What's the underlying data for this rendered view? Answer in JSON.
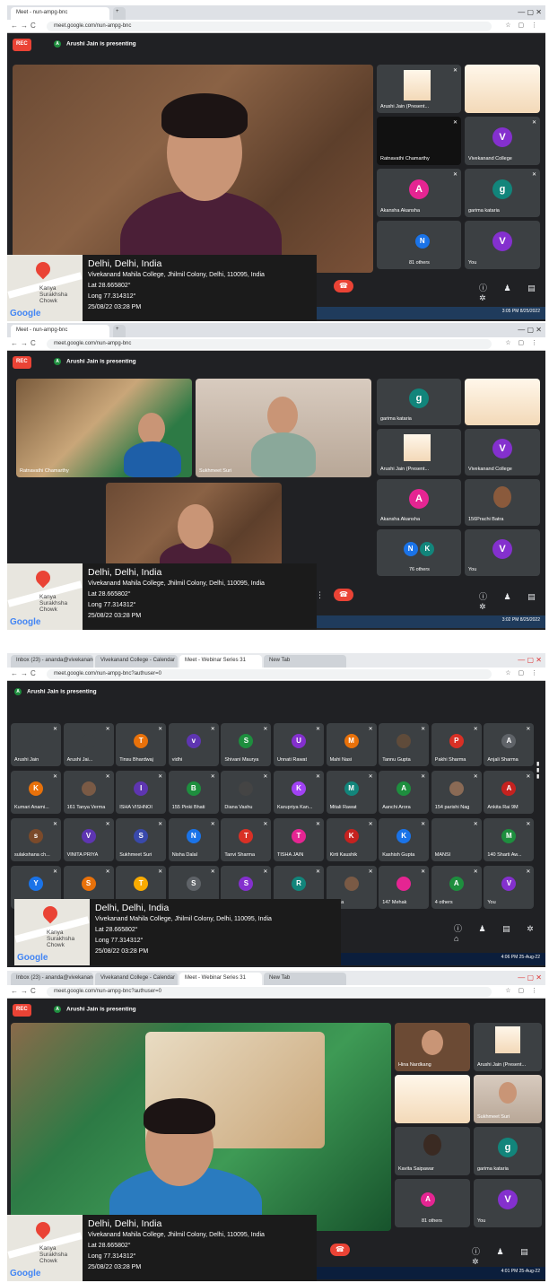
{
  "shot1": {
    "tab_title": "Meet - nun-ampg-bnc",
    "url": "meet.google.com/nun-ampg-bnc",
    "rec_label": "REC",
    "presenting_avatar": "A",
    "presenting_text": "Arushi Jain is presenting",
    "tiles": [
      {
        "name": "Arushi Jain (Present...",
        "avatar": ""
      },
      {
        "name": "",
        "avatar": ""
      },
      {
        "name": "Ratnavathi Chamarthy",
        "avatar": ""
      },
      {
        "name": "Vivekanand College",
        "avatar": "V"
      },
      {
        "name": "Akansha Akansha",
        "avatar": "A"
      },
      {
        "name": "garima kataria",
        "avatar": "g"
      },
      {
        "name": "81 others",
        "avatar": "N"
      },
      {
        "name": "You",
        "avatar": "V"
      }
    ],
    "taskbar_time": "3:05 PM",
    "taskbar_date": "8/25/2022"
  },
  "shot2": {
    "tab_title": "Meet - nun-ampg-bnc",
    "url": "meet.google.com/nun-ampg-bnc",
    "rec_label": "REC",
    "presenting_avatar": "A",
    "presenting_text": "Arushi Jain is presenting",
    "tiles": [
      {
        "name": "Ratnavathi Chamarthy",
        "avatar": ""
      },
      {
        "name": "Sukhmeet Suri",
        "avatar": ""
      },
      {
        "name": "garima kataria",
        "avatar": "g"
      },
      {
        "name": "",
        "avatar": ""
      },
      {
        "name": "Arushi Jain (Present...",
        "avatar": ""
      },
      {
        "name": "Vivekanand College",
        "avatar": "V"
      },
      {
        "name": "Akansha Akansha",
        "avatar": "A"
      },
      {
        "name": "156Prachi Batra",
        "avatar": ""
      },
      {
        "name": "76 others",
        "avatar": "N"
      },
      {
        "name": "You",
        "avatar": "V"
      }
    ],
    "others_second_avatar": "K",
    "taskbar_time": "3:02 PM",
    "taskbar_date": "8/25/2022"
  },
  "shot3": {
    "tabs": [
      "Inbox (23) - ananda@vivekanand...",
      "Vivekanand College - Calendar",
      "Meet - Webinar Series 31",
      "New Tab"
    ],
    "url": "meet.google.com/nun-ampg-bnc?authuser=0",
    "presenting_avatar": "A",
    "presenting_text": "Arushi Jain is presenting",
    "grid": [
      {
        "name": "Arushi Jain",
        "avatar": "",
        "color": "#3c4043"
      },
      {
        "name": "Arushi Jai...",
        "avatar": "",
        "color": "#3c4043"
      },
      {
        "name": "Tinsu Bhardwaj",
        "avatar": "T",
        "color": "#e8710a"
      },
      {
        "name": "vidhi",
        "avatar": "v",
        "color": "#5e35b1"
      },
      {
        "name": "Shivani Maurya",
        "avatar": "S",
        "color": "#1e8e3e"
      },
      {
        "name": "Unnati Rawat",
        "avatar": "U",
        "color": "#8430ce"
      },
      {
        "name": "Mahi Nasi",
        "avatar": "M",
        "color": "#e8710a"
      },
      {
        "name": "Tannu Gupta",
        "avatar": "",
        "color": "#5f4b3a"
      },
      {
        "name": "Pakhi Sharma",
        "avatar": "P",
        "color": "#d93025"
      },
      {
        "name": "Anjali Sharma",
        "avatar": "A",
        "color": "#5f6368"
      },
      {
        "name": "Kumari Anami...",
        "avatar": "K",
        "color": "#e8710a"
      },
      {
        "name": "161 Tanya Verma",
        "avatar": "",
        "color": "#7a5a45"
      },
      {
        "name": "ISHA VISHNOI",
        "avatar": "I",
        "color": "#5e35b1"
      },
      {
        "name": "155 Pinki Bhati",
        "avatar": "B",
        "color": "#1e8e3e"
      },
      {
        "name": "Diana Vashu",
        "avatar": "",
        "color": "#444"
      },
      {
        "name": "Karupriya Kan...",
        "avatar": "K",
        "color": "#a142f4"
      },
      {
        "name": "Mitali Rawat",
        "avatar": "M",
        "color": "#12857b"
      },
      {
        "name": "Aanchi Arora",
        "avatar": "A",
        "color": "#1e8e3e"
      },
      {
        "name": "154 parishi Nag",
        "avatar": "",
        "color": "#8a6a55"
      },
      {
        "name": "Ankita Rai 9M",
        "avatar": "A",
        "color": "#c5221f"
      },
      {
        "name": "sulakshana ch...",
        "avatar": "s",
        "color": "#7b4a2a"
      },
      {
        "name": "VINITA PRIYA",
        "avatar": "V",
        "color": "#5e35b1"
      },
      {
        "name": "Sukhmeet Suri",
        "avatar": "S",
        "color": "#3949ab"
      },
      {
        "name": "Nisha Dalal",
        "avatar": "N",
        "color": "#1a73e8"
      },
      {
        "name": "Tanvi Sharma",
        "avatar": "T",
        "color": "#d93025"
      },
      {
        "name": "TISHA JAIN",
        "avatar": "T",
        "color": "#e52592"
      },
      {
        "name": "Kirti Kaushik",
        "avatar": "K",
        "color": "#c5221f"
      },
      {
        "name": "Kashish Gupta",
        "avatar": "K",
        "color": "#1a73e8"
      },
      {
        "name": "MANSI",
        "avatar": "",
        "color": "#3c4043"
      },
      {
        "name": "140 Sharti Aw...",
        "avatar": "M",
        "color": "#1e8e3e"
      },
      {
        "name": "",
        "avatar": "Y",
        "color": "#1a73e8"
      },
      {
        "name": "",
        "avatar": "S",
        "color": "#e8710a"
      },
      {
        "name": "",
        "avatar": "T",
        "color": "#f9ab00"
      },
      {
        "name": "",
        "avatar": "S",
        "color": "#5f6368"
      },
      {
        "name": "",
        "avatar": "S",
        "color": "#8430ce"
      },
      {
        "name": "",
        "avatar": "R",
        "color": "#12857b"
      },
      {
        "name": "...ehra",
        "avatar": "",
        "color": "#7a5a45"
      },
      {
        "name": "147 Mehak",
        "avatar": "",
        "color": "#e52592"
      },
      {
        "name": "4 others",
        "avatar": "A",
        "color": "#1e8e3e"
      },
      {
        "name": "You",
        "avatar": "V",
        "color": "#8430ce"
      }
    ],
    "taskbar_time": "4:06 PM",
    "taskbar_date": "25-Aug-22"
  },
  "shot4": {
    "tabs": [
      "Inbox (23) - ananda@vivekanand...",
      "Vivekanand College - Calendar",
      "Meet - Webinar Series 31",
      "New Tab"
    ],
    "url": "meet.google.com/nun-ampg-bnc?authuser=0",
    "rec_label": "REC",
    "presenting_avatar": "A",
    "presenting_text": "Arushi Jain is presenting",
    "tiles": [
      {
        "name": "Hina Nardkang",
        "avatar": ""
      },
      {
        "name": "Arushi Jain (Present...",
        "avatar": ""
      },
      {
        "name": "",
        "avatar": ""
      },
      {
        "name": "Sukhmeet Suri",
        "avatar": ""
      },
      {
        "name": "Kavita Saipawar",
        "avatar": ""
      },
      {
        "name": "garima kataria",
        "avatar": "g"
      },
      {
        "name": "81 others",
        "avatar": "A"
      },
      {
        "name": "You",
        "avatar": "V"
      }
    ],
    "taskbar_time": "4:01 PM",
    "taskbar_date": "25-Aug-22"
  },
  "geo": {
    "map_label_1": "Kanya",
    "map_label_2": "Surakhsha",
    "map_label_3": "Chowk",
    "map_logo": "Google",
    "city": "Delhi, Delhi, India",
    "address": "Vivekanand Mahila College, Jhilmil Colony, Delhi, 110095, India",
    "lat": "Lat 28.665802°",
    "long": "Long 77.314312°",
    "datetime": "25/08/22 03:28 PM"
  },
  "icons": {
    "end_call": "phone-hangup-icon",
    "info": "info-icon",
    "people": "people-icon",
    "chat": "chat-icon",
    "activities": "activities-icon",
    "mic_off": "mic-off-icon"
  },
  "colors": {
    "meet_bg": "#202124",
    "tile_bg": "#3c4043",
    "rec_red": "#ea4335",
    "present_green": "#1e8e3e",
    "avatar_purple": "#8430ce",
    "avatar_green": "#1e8e3e",
    "avatar_pink": "#e52592"
  }
}
